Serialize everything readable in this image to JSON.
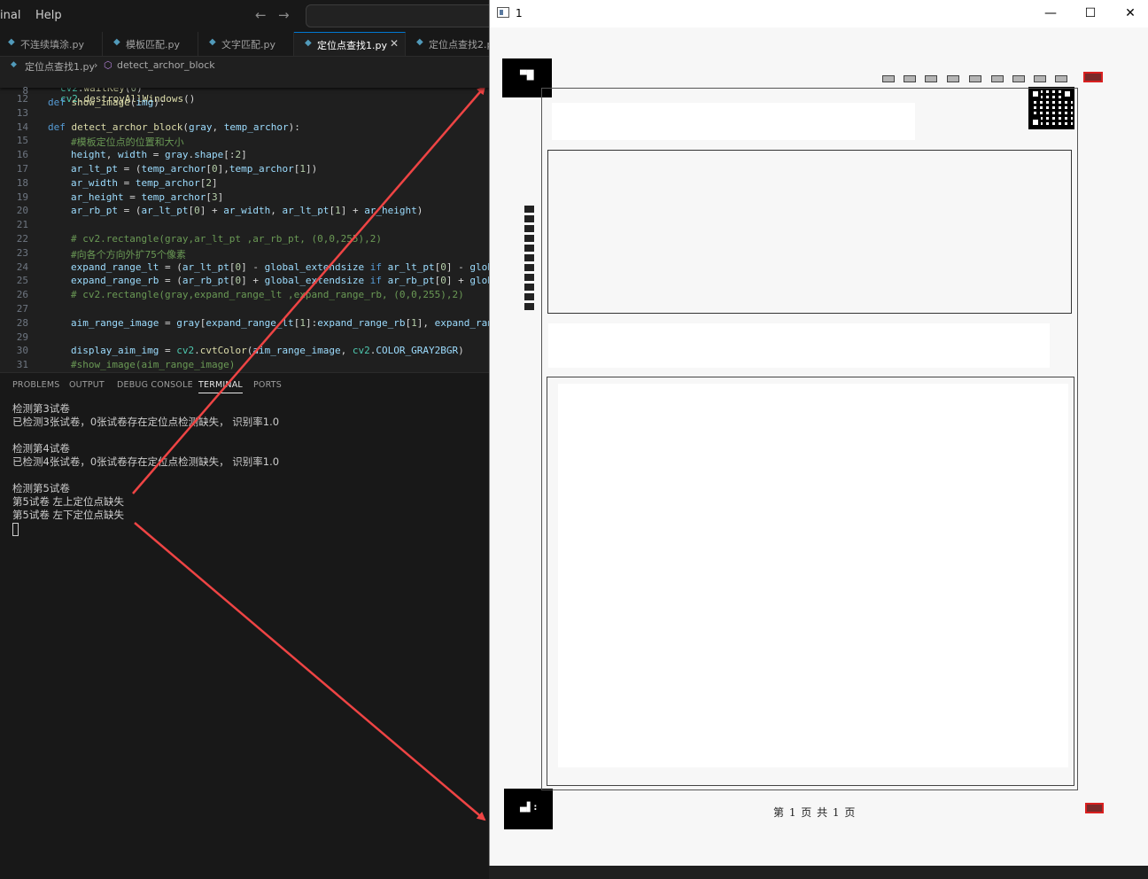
{
  "menubar": {
    "items": [
      "inal",
      "Help"
    ]
  },
  "tabs": [
    {
      "label": "不连续填涂.py"
    },
    {
      "label": "模板匹配.py"
    },
    {
      "label": "文字匹配.py"
    },
    {
      "label": "定位点查找1.py",
      "close": "✕"
    },
    {
      "label": "定位点查找2.p"
    }
  ],
  "breadcrumb": {
    "file": "定位点查找1.py",
    "sep": "›",
    "symbol": "detect_archor_block"
  },
  "editor": {
    "sticky": {
      "ln": "8",
      "code": "def show_image(img):"
    },
    "lines": [
      {
        "ln": "",
        "code": "cv2.waitKey(0)"
      },
      {
        "ln": "12",
        "code": "cv2.destroyAllWindows()"
      },
      {
        "ln": "13",
        "code": ""
      },
      {
        "ln": "14",
        "code": "def detect_archor_block(gray, temp_archor):"
      },
      {
        "ln": "15",
        "code": "#模板定位点的位置和大小"
      },
      {
        "ln": "16",
        "code": "height, width = gray.shape[:2]"
      },
      {
        "ln": "17",
        "code": "ar_lt_pt = (temp_archor[0],temp_archor[1])"
      },
      {
        "ln": "18",
        "code": "ar_width = temp_archor[2]"
      },
      {
        "ln": "19",
        "code": "ar_height = temp_archor[3]"
      },
      {
        "ln": "20",
        "code": "ar_rb_pt = (ar_lt_pt[0] + ar_width, ar_lt_pt[1] + ar_height)"
      },
      {
        "ln": "21",
        "code": ""
      },
      {
        "ln": "22",
        "code": "# cv2.rectangle(gray,ar_lt_pt ,ar_rb_pt, (0,0,255),2)"
      },
      {
        "ln": "23",
        "code": "#向各个方向外扩75个像素"
      },
      {
        "ln": "24",
        "code": "expand_range_lt = (ar_lt_pt[0] - global_extendsize if ar_lt_pt[0] - global_"
      },
      {
        "ln": "25",
        "code": "expand_range_rb = (ar_rb_pt[0] + global_extendsize if ar_rb_pt[0] + global_"
      },
      {
        "ln": "26",
        "code": "# cv2.rectangle(gray,expand_range_lt ,expand_range_rb, (0,0,255),2)"
      },
      {
        "ln": "27",
        "code": ""
      },
      {
        "ln": "28",
        "code": "aim_range_image = gray[expand_range_lt[1]:expand_range_rb[1], expand_range_"
      },
      {
        "ln": "29",
        "code": ""
      },
      {
        "ln": "30",
        "code": "display_aim_img = cv2.cvtColor(aim_range_image, cv2.COLOR_GRAY2BGR)"
      },
      {
        "ln": "31",
        "code": "#show_image(aim_range_image)"
      }
    ]
  },
  "panel": {
    "tabs": [
      "PROBLEMS",
      "OUTPUT",
      "DEBUG CONSOLE",
      "TERMINAL",
      "PORTS"
    ],
    "terminal": [
      "检测第3试卷",
      "已检测3张试卷，0张试卷存在定位点检测缺失， 识别率1.0",
      "",
      "检测第4试卷",
      "已检测4张试卷，0张试卷存在定位点检测缺失， 识别率1.0",
      "",
      "检测第5试卷",
      "第5试卷 左上定位点缺失",
      "第5试卷 左下定位点缺失"
    ]
  },
  "image_window": {
    "title": "1",
    "controls": {
      "minimize": "—",
      "maximize": "☐",
      "close": "✕"
    },
    "footer": "第 1 页 共 1 页"
  },
  "colors": {
    "accent": "#0078d4",
    "arrow": "#ee4444",
    "marker_red": "#d92020"
  }
}
